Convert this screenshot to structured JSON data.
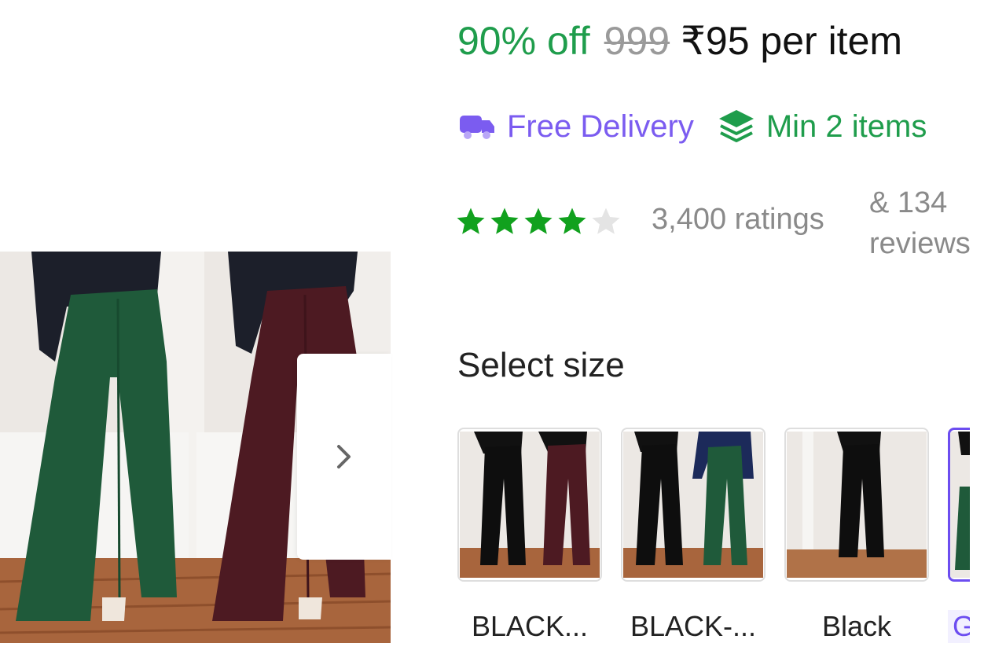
{
  "price": {
    "discount": "90% off",
    "mrp": "999",
    "current": "₹95 per item"
  },
  "badges": {
    "free_delivery": "Free Delivery",
    "min_items": "Min 2 items"
  },
  "rating": {
    "stars_filled": 4,
    "stars_total": 5,
    "count": "3,400 ratings",
    "reviews": "& 134 reviews"
  },
  "colors": {
    "green": "#1f9d4c",
    "star_green": "#11a11e",
    "purple": "#7b5cf0",
    "star_empty": "#e4e4e4"
  },
  "size_section": {
    "title": "Select size"
  },
  "variants": [
    {
      "label": "BLACK...",
      "selected": false
    },
    {
      "label": "BLACK-...",
      "selected": false
    },
    {
      "label": "Black",
      "selected": false
    },
    {
      "label": "G",
      "selected": true
    }
  ],
  "icons": {
    "truck": "delivery-truck-icon",
    "layers": "stacked-layers-icon",
    "next": "chevron-right-icon"
  }
}
